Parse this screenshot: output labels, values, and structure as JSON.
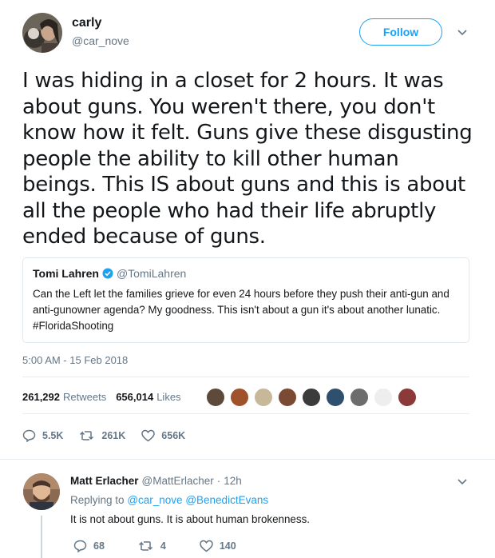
{
  "tweet": {
    "user": {
      "name": "carly",
      "handle": "@car_nove",
      "avatar": "user-avatar-photo"
    },
    "follow_label": "Follow",
    "text": "I was hiding in a closet for 2 hours. It was about guns. You weren't there, you don't know how it felt. Guns give these disgusting people the ability to kill other human beings. This IS about guns and this is about all the people who had their life abruptly ended because of guns.",
    "quote": {
      "name": "Tomi Lahren",
      "handle": "@TomiLahren",
      "text": "Can the Left let the families grieve for even 24 hours before they push their anti-gun and anti-gunowner agenda? My goodness. This isn't about a gun it's about another lunatic. #FloridaShooting"
    },
    "timestamp": "5:00 AM - 15 Feb 2018",
    "stats": {
      "retweets_count": "261,292",
      "retweets_label": "Retweets",
      "likes_count": "656,014",
      "likes_label": "Likes"
    },
    "actions": {
      "replies": "5.5K",
      "retweets": "261K",
      "likes": "656K"
    }
  },
  "reply": {
    "name": "Matt Erlacher",
    "handle": "@MattErlacher",
    "separator": "·",
    "time": "12h",
    "replying_prefix": "Replying to",
    "replying_to_1": "@car_nove",
    "replying_to_2": "@BenedictEvans",
    "text": "It is not about guns. It is about human brokenness.",
    "actions": {
      "replies": "68",
      "retweets": "4",
      "likes": "140"
    }
  },
  "colors": {
    "accent": "#1da1f2",
    "muted": "#657786",
    "text": "#14171a",
    "border": "#e6ecf0"
  }
}
